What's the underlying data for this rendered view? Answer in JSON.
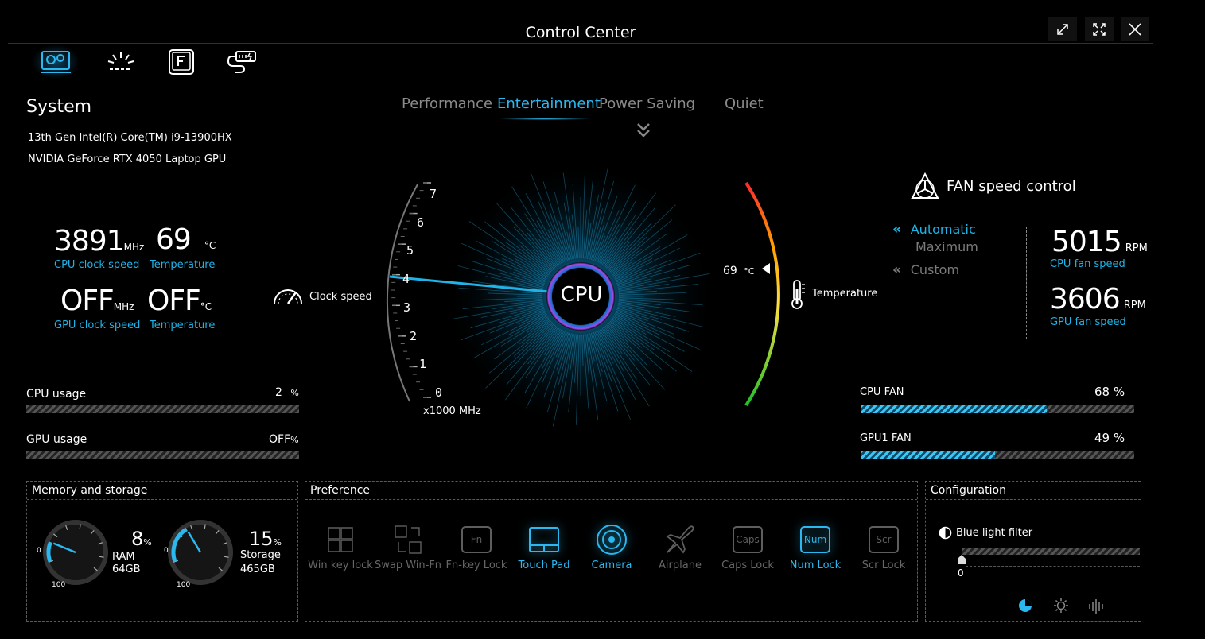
{
  "window": {
    "title": "Control Center"
  },
  "nav": {
    "items": [
      "system-icon",
      "lighting-icon",
      "fn-key-icon",
      "battery-plug-icon"
    ]
  },
  "system": {
    "heading": "System",
    "cpu_name": "13th Gen Intel(R) Core(TM) i9-13900HX",
    "gpu_name": "NVIDIA GeForce RTX 4050 Laptop GPU",
    "cpu_clock": "3891",
    "cpu_clock_unit": "MHz",
    "cpu_clock_label": "CPU clock speed",
    "cpu_temp": "69",
    "cpu_temp_unit": "°C",
    "cpu_temp_label": "Temperature",
    "gpu_clock": "OFF",
    "gpu_clock_unit": "MHz",
    "gpu_clock_label": "GPU clock speed",
    "gpu_temp": "OFF",
    "gpu_temp_unit": "°C",
    "gpu_temp_label": "Temperature"
  },
  "usage": {
    "cpu_label": "CPU usage",
    "cpu_value": "2",
    "cpu_unit": "%",
    "gpu_label": "GPU usage",
    "gpu_value": "OFF",
    "gpu_unit": "%"
  },
  "modes": {
    "tabs": [
      "Performance",
      "Entertainment",
      "Power Saving",
      "Quiet"
    ],
    "active": "Entertainment"
  },
  "gauge": {
    "center_label": "CPU",
    "clock_label": "Clock speed",
    "temp_label": "Temperature",
    "scale_unit": "x1000 MHz",
    "ticks": [
      "7",
      "6",
      "5",
      "4",
      "3",
      "2",
      "1",
      "0"
    ],
    "clock_value": 3.891,
    "temp_reading": "69",
    "temp_unit": "°C"
  },
  "fan": {
    "heading": "FAN speed control",
    "modes": [
      "Automatic",
      "Maximum",
      "Custom"
    ],
    "active_mode": "Automatic",
    "cpu_rpm": "5015",
    "cpu_rpm_unit": "RPM",
    "cpu_rpm_label": "CPU fan speed",
    "gpu_rpm": "3606",
    "gpu_rpm_unit": "RPM",
    "gpu_rpm_label": "GPU fan speed",
    "cpu_fan_label": "CPU FAN",
    "cpu_fan_value": "68 %",
    "cpu_fan_pct": 68,
    "gpu_fan_label": "GPU1 FAN",
    "gpu_fan_value": "49 %",
    "gpu_fan_pct": 49
  },
  "memory": {
    "heading": "Memory and storage",
    "ram_pct": "8",
    "ram_unit": "%",
    "ram_label": "RAM",
    "ram_size": "64GB",
    "ram_value": 8,
    "storage_pct": "15",
    "storage_unit": "%",
    "storage_label": "Storage",
    "storage_size": "465GB",
    "storage_value": 15,
    "scale_min": "0",
    "scale_max": "100"
  },
  "preference": {
    "heading": "Preference",
    "items": [
      {
        "label": "Win key lock",
        "icon": "windows-icon",
        "active": false
      },
      {
        "label": "Swap Win-Fn",
        "icon": "swap-icon",
        "active": false
      },
      {
        "label": "Fn-key Lock",
        "icon": "fn-icon",
        "key": "Fn",
        "active": false
      },
      {
        "label": "Touch Pad",
        "icon": "touchpad-icon",
        "active": true
      },
      {
        "label": "Camera",
        "icon": "camera-icon",
        "active": true
      },
      {
        "label": "Airplane",
        "icon": "airplane-icon",
        "active": false
      },
      {
        "label": "Caps Lock",
        "icon": "caps-icon",
        "key": "Caps",
        "active": false
      },
      {
        "label": "Num Lock",
        "icon": "num-icon",
        "key": "Num",
        "active": true
      },
      {
        "label": "Scr Lock",
        "icon": "scr-icon",
        "key": "Scr",
        "active": false
      }
    ]
  },
  "configuration": {
    "heading": "Configuration",
    "blue_light_label": "Blue light filter",
    "blue_light_value": "0"
  },
  "colors": {
    "accent": "#1fb4e8",
    "inactive": "#7a7a7a"
  }
}
